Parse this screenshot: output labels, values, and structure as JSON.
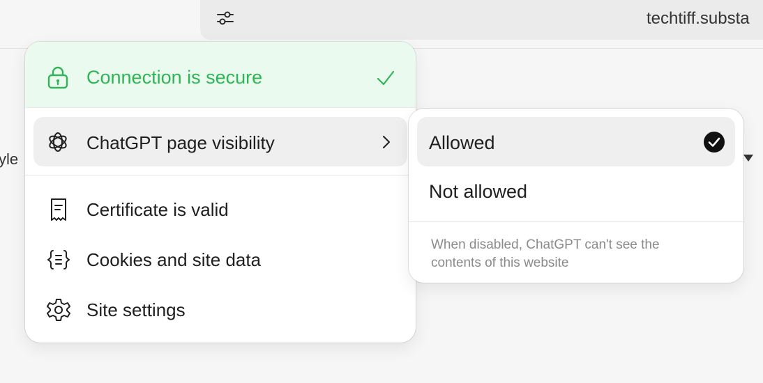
{
  "browser": {
    "url_text": "techtiff.substa",
    "side_fragment": "yle",
    "icons": {
      "tune": "tune-icon",
      "caret": "caret-down-icon"
    }
  },
  "site_info_panel": {
    "security": {
      "label": "Connection is secure",
      "icon": "lock-icon",
      "status_icon": "check-icon",
      "color": "#2fb556",
      "background": "#ebfaef"
    },
    "items": [
      {
        "label": "ChatGPT page visibility",
        "icon": "chatgpt-icon",
        "has_submenu": true
      },
      {
        "label": "Certificate is valid",
        "icon": "certificate-icon"
      },
      {
        "label": "Cookies and site data",
        "icon": "cookies-icon"
      },
      {
        "label": "Site settings",
        "icon": "gear-icon"
      }
    ]
  },
  "visibility_submenu": {
    "options": [
      {
        "label": "Allowed",
        "selected": true
      },
      {
        "label": "Not allowed",
        "selected": false
      }
    ],
    "note": "When disabled, ChatGPT can't see the contents of this website"
  }
}
